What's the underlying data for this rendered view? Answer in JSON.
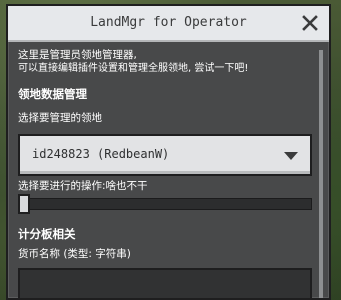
{
  "window": {
    "title": "LandMgr for Operator"
  },
  "intro": {
    "line1": "这里是管理员领地管理器,",
    "line2": "可以直接编辑插件设置和管理全服领地, 尝试一下吧!"
  },
  "land_section": {
    "header": "领地数据管理",
    "select_label": "选择要管理的领地",
    "selected_land": "id248823 (RedbeanW)",
    "operation_label": "选择要进行的操作:啥也不干",
    "operation_slider_value": 0
  },
  "scoreboard_section": {
    "header": "计分板相关",
    "currency_label": "货币名称 (类型: 字符串)",
    "currency_value": ""
  },
  "colors": {
    "panel": "#48494a",
    "titlebar": "#e6e8eb",
    "dropdown": "#e2e3e5",
    "text": "#ffffff"
  },
  "icons": {
    "close": "close-icon",
    "dropdown": "chevron-down-icon"
  }
}
